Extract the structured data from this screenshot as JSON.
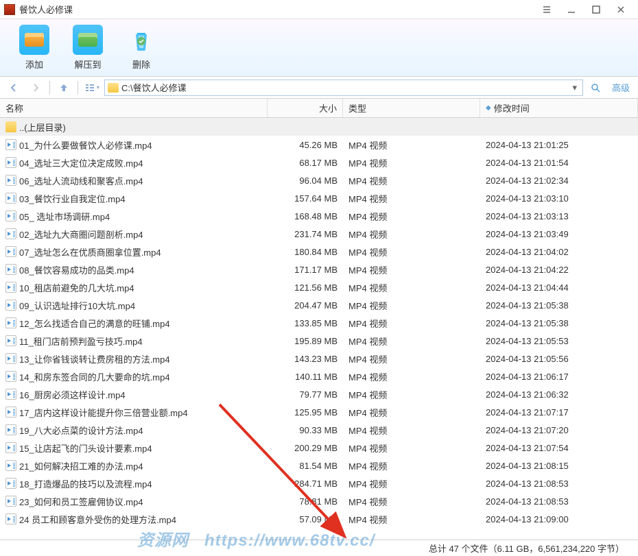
{
  "titlebar": {
    "title": "餐饮人必修课"
  },
  "toolbar": {
    "add": "添加",
    "extract": "解压到",
    "delete": "删除"
  },
  "navbar": {
    "path": "C:\\餐饮人必修课",
    "advanced": "高级"
  },
  "headers": {
    "name": "名称",
    "size": "大小",
    "type": "类型",
    "date": "修改时间"
  },
  "parent_row": {
    "label": "..(上层目录)"
  },
  "files": [
    {
      "name": "01_为什么要做餐饮人必修课.mp4",
      "size": "45.26 MB",
      "type": "MP4 视频",
      "date": "2024-04-13 21:01:25"
    },
    {
      "name": "04_选址三大定位决定成败.mp4",
      "size": "68.17 MB",
      "type": "MP4 视频",
      "date": "2024-04-13 21:01:54"
    },
    {
      "name": "06_选址人流动线和聚客点.mp4",
      "size": "96.04 MB",
      "type": "MP4 视频",
      "date": "2024-04-13 21:02:34"
    },
    {
      "name": "03_餐饮行业自我定位.mp4",
      "size": "157.64 MB",
      "type": "MP4 视频",
      "date": "2024-04-13 21:03:10"
    },
    {
      "name": "05_ 选址市场调研.mp4",
      "size": "168.48 MB",
      "type": "MP4 视频",
      "date": "2024-04-13 21:03:13"
    },
    {
      "name": "02_选址九大商圈问题剖析.mp4",
      "size": "231.74 MB",
      "type": "MP4 视频",
      "date": "2024-04-13 21:03:49"
    },
    {
      "name": "07_选址怎么在优质商圈拿位置.mp4",
      "size": "180.84 MB",
      "type": "MP4 视频",
      "date": "2024-04-13 21:04:02"
    },
    {
      "name": "08_餐饮容易成功的品类.mp4",
      "size": "171.17 MB",
      "type": "MP4 视频",
      "date": "2024-04-13 21:04:22"
    },
    {
      "name": "10_租店前避免的几大坑.mp4",
      "size": "121.56 MB",
      "type": "MP4 视频",
      "date": "2024-04-13 21:04:44"
    },
    {
      "name": "09_认识选址排行10大坑.mp4",
      "size": "204.47 MB",
      "type": "MP4 视频",
      "date": "2024-04-13 21:05:38"
    },
    {
      "name": "12_怎么找适合自己的满意的旺铺.mp4",
      "size": "133.85 MB",
      "type": "MP4 视频",
      "date": "2024-04-13 21:05:38"
    },
    {
      "name": "11_租门店前预判盈亏技巧.mp4",
      "size": "195.89 MB",
      "type": "MP4 视频",
      "date": "2024-04-13 21:05:53"
    },
    {
      "name": "13_让你省钱谈转让费房租的方法.mp4",
      "size": "143.23 MB",
      "type": "MP4 视频",
      "date": "2024-04-13 21:05:56"
    },
    {
      "name": "14_和房东签合同的几大要命的坑.mp4",
      "size": "140.11 MB",
      "type": "MP4 视频",
      "date": "2024-04-13 21:06:17"
    },
    {
      "name": "16_厨房必须这样设计.mp4",
      "size": "79.77 MB",
      "type": "MP4 视频",
      "date": "2024-04-13 21:06:32"
    },
    {
      "name": "17_店内这样设计能提升你三倍营业额.mp4",
      "size": "125.95 MB",
      "type": "MP4 视频",
      "date": "2024-04-13 21:07:17"
    },
    {
      "name": "19_八大必点菜的设计方法.mp4",
      "size": "90.33 MB",
      "type": "MP4 视频",
      "date": "2024-04-13 21:07:20"
    },
    {
      "name": "15_让店起飞的门头设计要素.mp4",
      "size": "200.29 MB",
      "type": "MP4 视频",
      "date": "2024-04-13 21:07:54"
    },
    {
      "name": "21_如何解决招工难的办法.mp4",
      "size": "81.54 MB",
      "type": "MP4 视频",
      "date": "2024-04-13 21:08:15"
    },
    {
      "name": "18_打造爆品的技巧以及流程.mp4",
      "size": "284.71 MB",
      "type": "MP4 视频",
      "date": "2024-04-13 21:08:53"
    },
    {
      "name": "23_如何和员工签雇佣协议.mp4",
      "size": "78.81 MB",
      "type": "MP4 视频",
      "date": "2024-04-13 21:08:53"
    },
    {
      "name": "24 员工和顾客意外受伤的处理方法.mp4",
      "size": "57.09 MB",
      "type": "MP4 视频",
      "date": "2024-04-13 21:09:00"
    }
  ],
  "statusbar": {
    "text": "总计 47 个文件（6.11 GB，6,561,234,220 字节）"
  },
  "watermark": {
    "text1": "资源网",
    "text2": "https://www.68tv.cc/"
  }
}
